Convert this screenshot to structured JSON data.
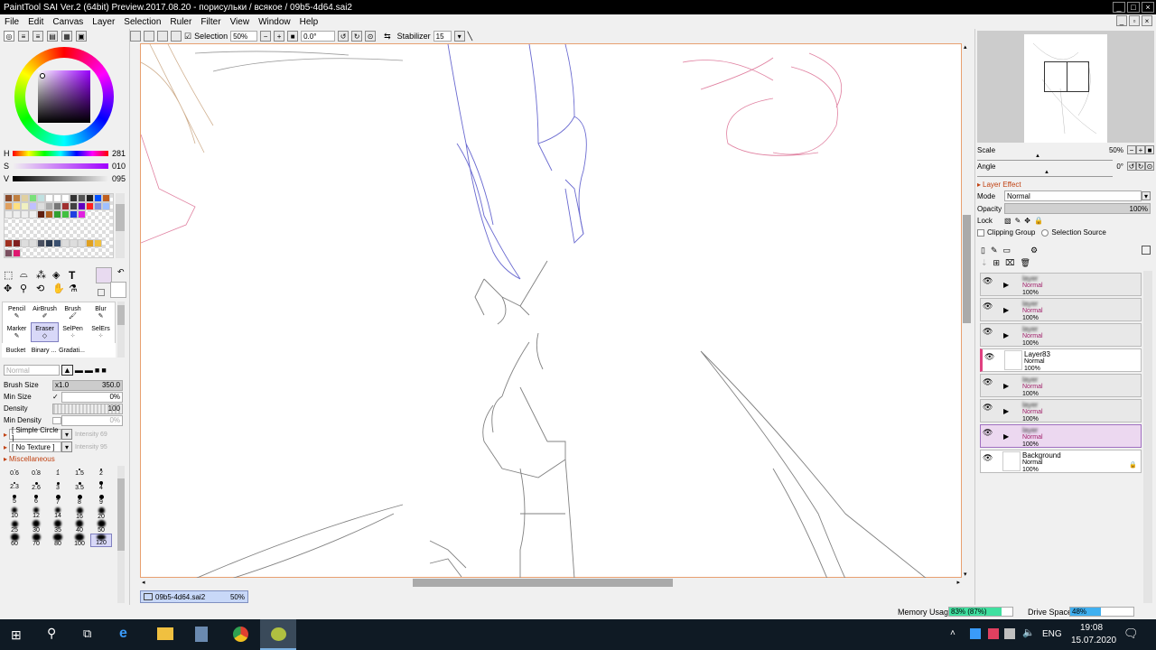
{
  "window": {
    "title": "PaintTool SAI Ver.2 (64bit) Preview.2017.08.20 - порисульки / всякое / 09b5-4d64.sai2"
  },
  "menu": [
    "File",
    "Edit",
    "Canvas",
    "Layer",
    "Selection",
    "Ruler",
    "Filter",
    "View",
    "Window",
    "Help"
  ],
  "toolbar": {
    "selection_label": "Selection",
    "zoom": "50%",
    "angle": "0.0°",
    "stabilizer_label": "Stabilizer",
    "stabilizer_value": "15"
  },
  "color": {
    "h_label": "H",
    "h_value": "281",
    "s_label": "S",
    "s_value": "010",
    "v_label": "V",
    "v_value": "095",
    "current_hex": "#e8daf0"
  },
  "tools": {
    "row1": [
      "Pencil",
      "AirBrush",
      "Brush",
      "Blur"
    ],
    "row2": [
      "Marker",
      "Eraser",
      "SelPen",
      "SelErs"
    ],
    "row3": [
      "Bucket",
      "Binary ...",
      "Gradati..."
    ],
    "selected": "Eraser"
  },
  "brush": {
    "mode": "Normal",
    "size_label": "Brush Size",
    "size_mult": "x1.0",
    "size_value": "350.0",
    "minsize_label": "Min Size",
    "minsize_value": "0%",
    "density_label": "Density",
    "density_value": "100",
    "mindensity_label": "Min Density",
    "mindensity_value": "0%",
    "shape": "[ Simple Circle ]",
    "shape_intensity": "Intensity 69",
    "texture": "[ No Texture ]",
    "texture_intensity": "Intensity 95",
    "misc_label": "Miscellaneous"
  },
  "brush_sizes": [
    "0.6",
    "0.8",
    "1",
    "1.5",
    "2",
    "2.3",
    "2.6",
    "3",
    "3.5",
    "4",
    "5",
    "6",
    "7",
    "8",
    "9",
    "10",
    "12",
    "14",
    "16",
    "20",
    "25",
    "30",
    "35",
    "40",
    "50",
    "60",
    "70",
    "80",
    "100",
    "120"
  ],
  "navigator": {
    "scale_label": "Scale",
    "scale_value": "50%",
    "angle_label": "Angle",
    "angle_value": "0°"
  },
  "layer_effect": {
    "header": "Layer Effect",
    "mode_label": "Mode",
    "mode_value": "Normal",
    "opacity_label": "Opacity",
    "opacity_value": "100%",
    "lock_label": "Lock",
    "clipping_label": "Clipping Group",
    "selsource_label": "Selection Source"
  },
  "layers": [
    {
      "name": "layer",
      "mode": "Normal",
      "pct": "100%",
      "folder": true,
      "blurred": true
    },
    {
      "name": "layer",
      "mode": "Normal",
      "pct": "100%",
      "folder": true,
      "blurred": true
    },
    {
      "name": "layer",
      "mode": "Normal",
      "pct": "100%",
      "folder": true,
      "blurred": true
    },
    {
      "name": "Layer83",
      "mode": "Normal",
      "pct": "100%",
      "folder": false,
      "blurred": false
    },
    {
      "name": "layer",
      "mode": "Normal",
      "pct": "100%",
      "folder": true,
      "blurred": true
    },
    {
      "name": "layer",
      "mode": "Normal",
      "pct": "100%",
      "folder": true,
      "blurred": true
    },
    {
      "name": "layer",
      "mode": "Normal",
      "pct": "100%",
      "folder": true,
      "blurred": true
    },
    {
      "name": "Background",
      "mode": "Normal",
      "pct": "100%",
      "folder": false,
      "blurred": false
    }
  ],
  "document": {
    "name": "09b5-4d64.sai2",
    "zoom": "50%"
  },
  "status": {
    "memory_label": "Memory Usage",
    "memory_value": "83% (87%)",
    "memory_fraction": 0.83,
    "drive_label": "Drive Space",
    "drive_value": "48%",
    "drive_fraction": 0.48
  },
  "taskbar": {
    "lang": "ENG",
    "time": "19:08",
    "date": "15.07.2020"
  }
}
